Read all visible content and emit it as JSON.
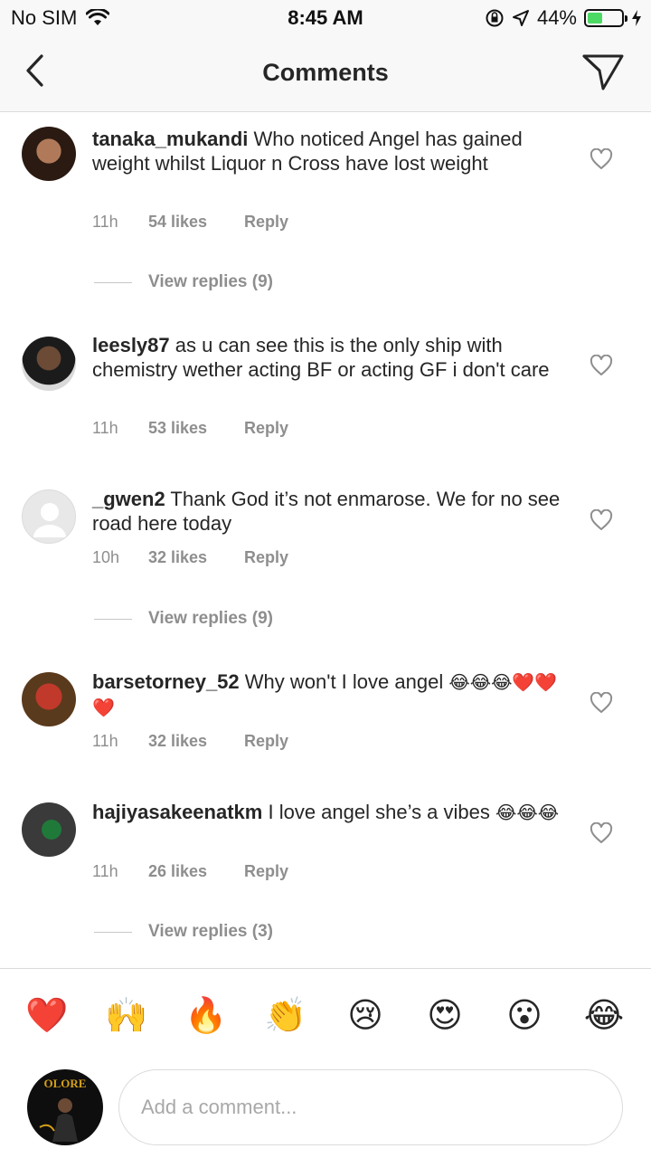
{
  "status_bar": {
    "carrier": "No SIM",
    "time": "8:45 AM",
    "battery_percent": "44%",
    "battery_level": 0.44
  },
  "header": {
    "title": "Comments",
    "back_icon": "chevron-left-icon",
    "send_icon": "paper-plane-icon"
  },
  "comments": [
    {
      "username": "tanaka_mukandi",
      "text": "Who noticed Angel has gained weight whilst Liquor n Cross have lost weight",
      "time": "11h",
      "likes": "54 likes",
      "reply": "Reply",
      "view_replies": "View replies (9)"
    },
    {
      "username": "leesly87",
      "text": "as u can see this is the only ship with chemistry wether acting BF or acting GF i don't care",
      "time": "11h",
      "likes": "53 likes",
      "reply": "Reply"
    },
    {
      "username": "_gwen2",
      "text": "Thank God it’s not enmarose. We for no see road here today",
      "time": "10h",
      "likes": "32 likes",
      "reply": "Reply",
      "view_replies": "View replies (9)"
    },
    {
      "username": "barsetorney_52",
      "text": "Why won't I love angel",
      "emojis": "😂😂😂❤️❤️❤️",
      "time": "11h",
      "likes": "32 likes",
      "reply": "Reply"
    },
    {
      "username": "hajiyasakeenatkm",
      "text": "I love angel she’s a vibes",
      "emojis": "😂😂😂",
      "time": "11h",
      "likes": "26 likes",
      "reply": "Reply",
      "view_replies": "View replies (3)"
    }
  ],
  "quick_emojis": [
    "❤️",
    "🙌",
    "🔥",
    "👏",
    "😢",
    "😍",
    "😮",
    "😂"
  ],
  "composer": {
    "placeholder": "Add a comment...",
    "avatar_text": "OLORE"
  },
  "colors": {
    "text": "#262626",
    "meta": "#8e8e8e",
    "battery_green": "#4cd964"
  }
}
